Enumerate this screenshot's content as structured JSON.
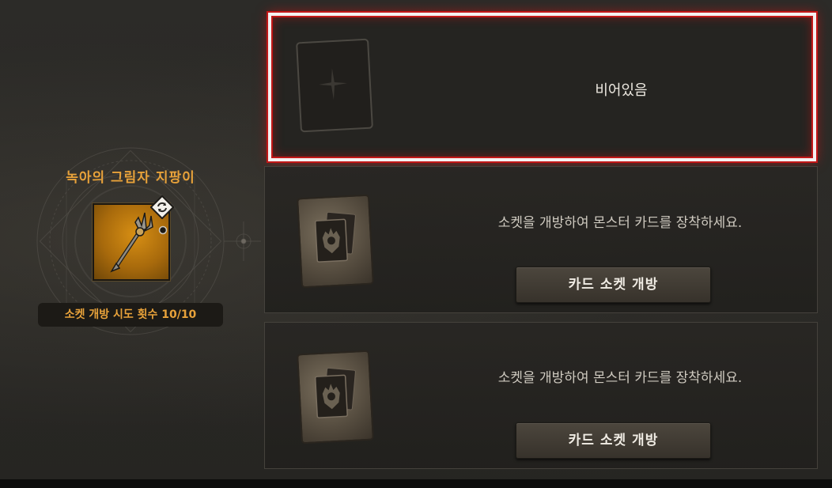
{
  "item": {
    "name": "녹아의 그림자 지팡이",
    "attempts_label": "소켓 개방 시도 횟수 10/10",
    "icons": {
      "weapon": "trident-staff-icon",
      "swap": "swap-arrows-icon"
    }
  },
  "slots": [
    {
      "state": "empty",
      "text": "비어있음",
      "card_icon": "sparkle-icon",
      "selected": true
    },
    {
      "state": "locked",
      "text": "소켓을 개방하여 몬스터 카드를 장착하세요.",
      "button_label": "카드 소켓 개방",
      "card_icon": "monster-card-icon"
    },
    {
      "state": "locked",
      "text": "소켓을 개방하여 몬스터 카드를 장착하세요.",
      "button_label": "카드 소켓 개방",
      "card_icon": "monster-card-icon"
    }
  ],
  "colors": {
    "accent": "#e8a23a",
    "selection": "#c21717"
  }
}
